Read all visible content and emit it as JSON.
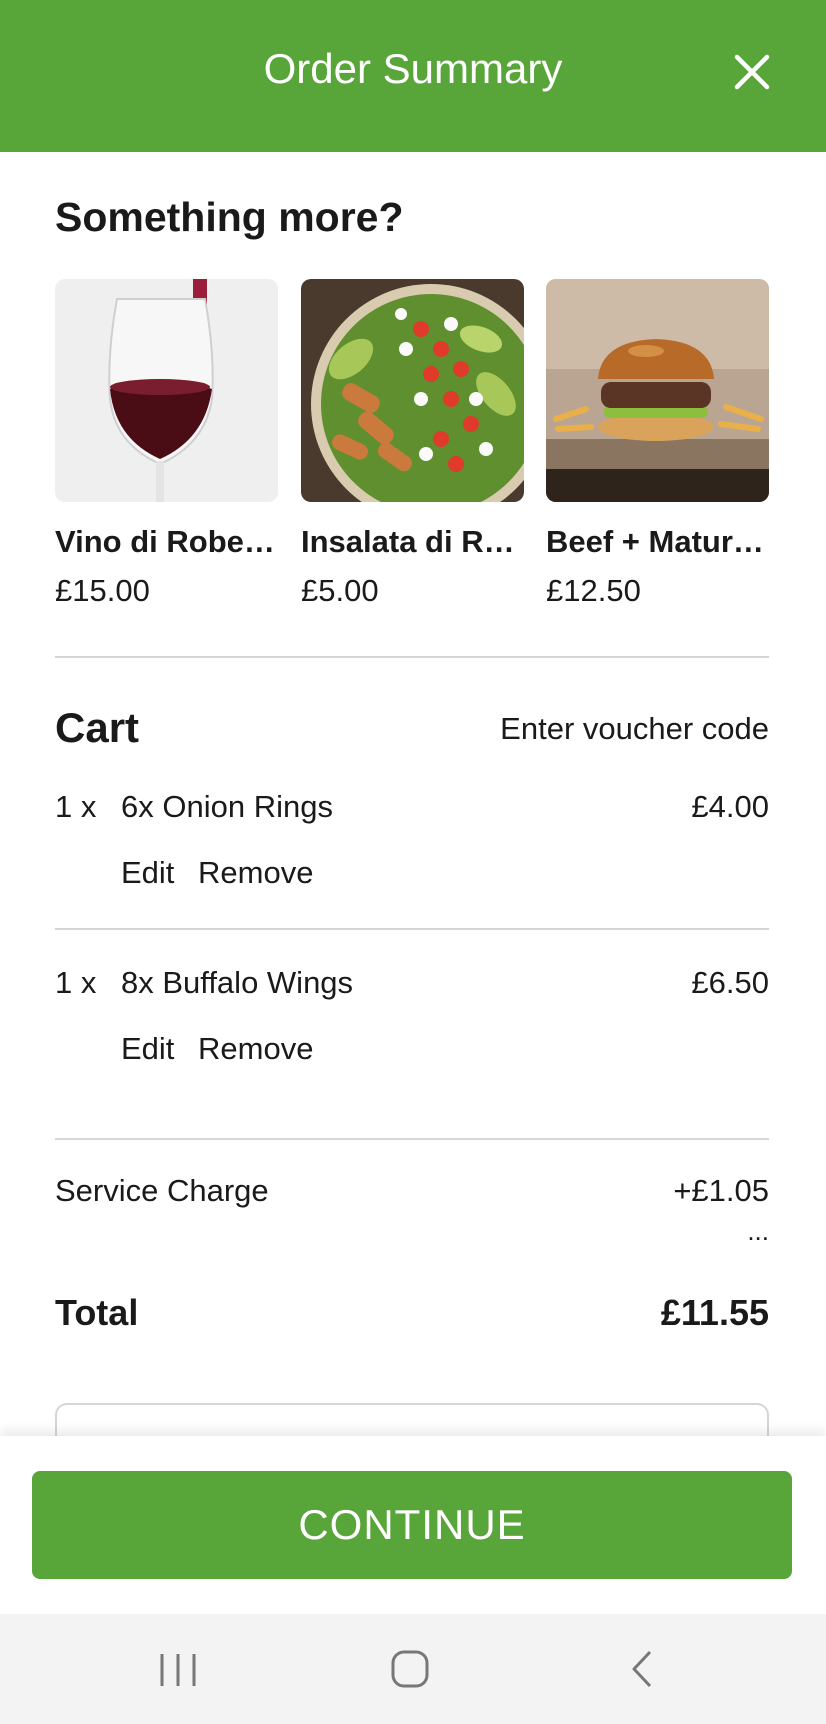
{
  "header": {
    "title": "Order Summary",
    "close_icon": "close-icon"
  },
  "upsell": {
    "title": "Something more?",
    "items": [
      {
        "name": "Vino di Rober…",
        "price": "£15.00",
        "image": "red-wine-glass"
      },
      {
        "name": "Insalata di Ro…",
        "price": "£5.00",
        "image": "chicken-salad-bowl"
      },
      {
        "name": "Beef + Matur…",
        "price": "£12.50",
        "image": "beef-burger-with-fries"
      }
    ]
  },
  "cart": {
    "title": "Cart",
    "voucher_label": "Enter voucher code",
    "items": [
      {
        "qty": "1 x",
        "name": "6x Onion Rings",
        "price": "£4.00",
        "edit_label": "Edit",
        "remove_label": "Remove"
      },
      {
        "qty": "1 x",
        "name": "8x Buffalo Wings",
        "price": "£6.50",
        "edit_label": "Edit",
        "remove_label": "Remove"
      }
    ]
  },
  "summary": {
    "service_label": "Service Charge",
    "service_value": "+£1.05",
    "more_label": "...",
    "total_label": "Total",
    "total_value": "£11.55"
  },
  "footer": {
    "continue_label": "CONTINUE"
  },
  "system_nav": {
    "icons": [
      "recent-apps-icon",
      "home-icon",
      "back-icon"
    ]
  },
  "colors": {
    "brand_green": "#58a53a",
    "divider": "#d6d6d6",
    "text": "#1a1a1a",
    "nav_bar": "#f3f3f3"
  }
}
